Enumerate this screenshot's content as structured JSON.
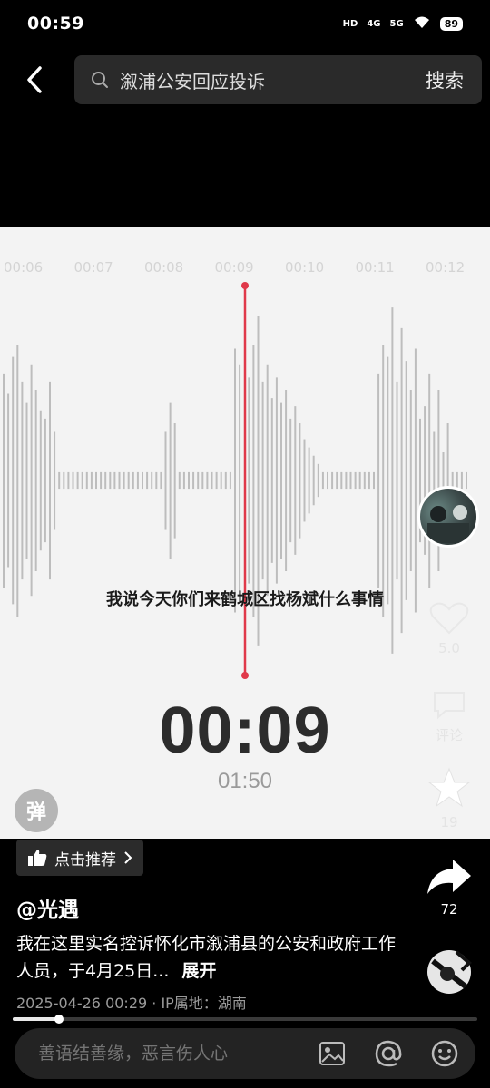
{
  "status_bar": {
    "time": "00:59",
    "icons": [
      "HD",
      "4G",
      "5G",
      "wifi-icon"
    ],
    "battery": "89"
  },
  "search": {
    "query": "溆浦公安回应投诉",
    "button_label": "搜索"
  },
  "player": {
    "timeline_labels": [
      "00:06",
      "00:07",
      "00:08",
      "00:09",
      "00:10",
      "00:11",
      "00:12"
    ],
    "subtitle": "我说今天你们来鹤城区找杨斌什么事情",
    "current_time": "00:09",
    "total_time": "01:50",
    "mark_glyph": "弹"
  },
  "actions": {
    "like_count": "5.0",
    "comment_label": "评论",
    "favorite_count": "19",
    "share_count": "72"
  },
  "post": {
    "recommend_label": "点击推荐",
    "author": "@光遇",
    "description": "我在这里实名控诉怀化市溆浦县的公安和政府工作人员，于4月25日...",
    "expand_label": "展开",
    "meta": "2025-04-26 00:29 · IP属地：湖南",
    "progress": 0.1
  },
  "comment": {
    "placeholder": "善语结善缘，恶言伤人心",
    "icons": [
      "image-icon",
      "at-icon",
      "emoji-icon"
    ]
  },
  "colors": {
    "playhead": "#e0394a",
    "wave": "#bdbdbd",
    "background": "#000000",
    "panel": "#f3f3f3"
  }
}
